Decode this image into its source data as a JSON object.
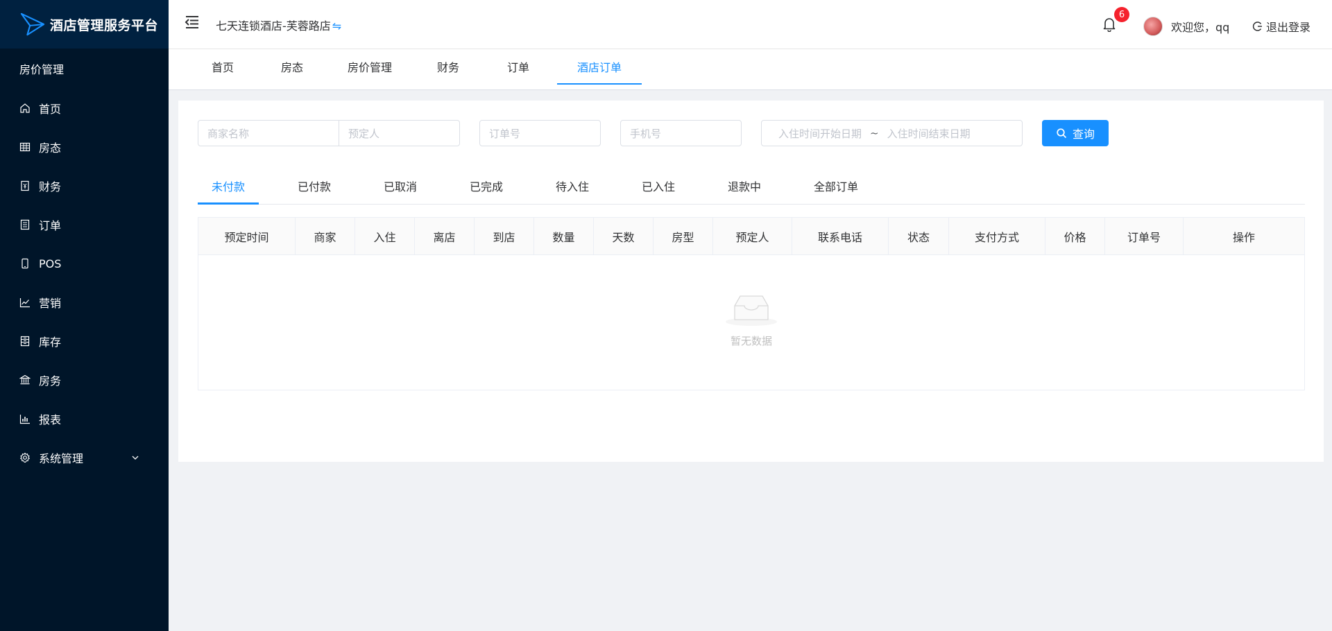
{
  "app": {
    "title": "酒店管理服务平台"
  },
  "sidebar": {
    "section_label": "房价管理",
    "items": [
      {
        "label": "首页",
        "icon": "home-icon"
      },
      {
        "label": "房态",
        "icon": "grid-icon"
      },
      {
        "label": "财务",
        "icon": "finance-icon"
      },
      {
        "label": "订单",
        "icon": "order-icon"
      },
      {
        "label": "POS",
        "icon": "mobile-icon"
      },
      {
        "label": "营销",
        "icon": "line-chart-icon"
      },
      {
        "label": "库存",
        "icon": "inventory-icon"
      },
      {
        "label": "房务",
        "icon": "bank-icon"
      },
      {
        "label": "报表",
        "icon": "bar-chart-icon"
      },
      {
        "label": "系统管理",
        "icon": "gear-icon"
      }
    ]
  },
  "header": {
    "hotel_name": "七天连锁酒店-芙蓉路店",
    "switch_symbol": "⇋",
    "notification_count": "6",
    "welcome": "欢迎您，qq",
    "logout": "退出登录"
  },
  "tabs": [
    "首页",
    "房态",
    "房价管理",
    "财务",
    "订单",
    "酒店订单"
  ],
  "active_tab": "酒店订单",
  "filters": {
    "merchant_placeholder": "商家名称",
    "booker_placeholder": "预定人",
    "order_no_placeholder": "订单号",
    "phone_placeholder": "手机号",
    "checkin_start_placeholder": "入住时间开始日期",
    "range_separator": "~",
    "checkin_end_placeholder": "入住时间结束日期",
    "query_button": "查询"
  },
  "status_tabs": [
    "未付款",
    "已付款",
    "已取消",
    "已完成",
    "待入住",
    "已入住",
    "退款中",
    "全部订单"
  ],
  "active_status_tab": "未付款",
  "table": {
    "columns": [
      "预定时间",
      "商家",
      "入住",
      "离店",
      "到店",
      "数量",
      "天数",
      "房型",
      "预定人",
      "联系电话",
      "状态",
      "支付方式",
      "价格",
      "订单号",
      "操作"
    ],
    "rows": [],
    "empty_text": "暂无数据"
  },
  "colors": {
    "sidebar_bg": "#001529",
    "brand_bg": "#002140",
    "accent": "#1890ff",
    "badge": "#f5222d",
    "page_bg": "#f0f2f5"
  }
}
